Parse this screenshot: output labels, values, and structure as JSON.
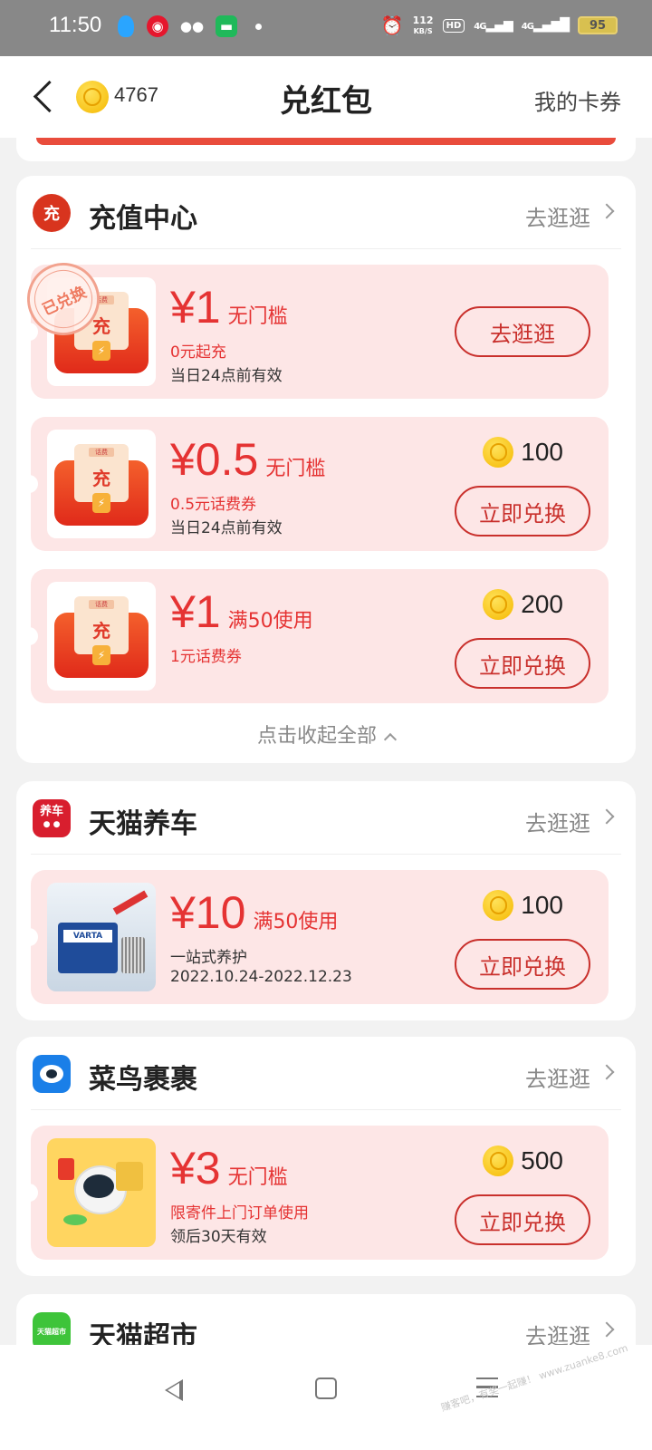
{
  "status_bar": {
    "time": "11:50",
    "network_speed_value": "112",
    "network_speed_unit": "KB/S",
    "hd_label": "HD",
    "signal_1": "4G",
    "signal_2": "4G",
    "battery": "95"
  },
  "header": {
    "coin_balance": "4767",
    "title": "兑红包",
    "my_coupons": "我的卡券"
  },
  "sections": [
    {
      "name": "充值中心",
      "logo_text": "充",
      "logo_color": "#d8341e",
      "link": "去逛逛",
      "coupons": [
        {
          "pack_tag": "话费",
          "pack_char": "充",
          "amount": "¥1",
          "condition": "无门槛",
          "line1": "0元起充",
          "line2": "当日24点前有效",
          "price": "",
          "button": "去逛逛",
          "stamp": "已兑换"
        },
        {
          "pack_tag": "话费",
          "pack_char": "充",
          "amount": "¥0.5",
          "condition": "无门槛",
          "line1": "0.5元话费券",
          "line2": "当日24点前有效",
          "price": "100",
          "button": "立即兑换"
        },
        {
          "pack_tag": "话费",
          "pack_char": "充",
          "amount": "¥1",
          "condition": "满50使用",
          "line1": "1元话费券",
          "line2": "",
          "price": "200",
          "button": "立即兑换"
        }
      ],
      "collapse_label": "点击收起全部"
    },
    {
      "name": "天猫养车",
      "logo_text": "养车",
      "logo_color": "#d81e2e",
      "link": "去逛逛",
      "coupons": [
        {
          "amount": "¥10",
          "condition": "满50使用",
          "line1": "一站式养护",
          "line2": "2022.10.24-2022.12.23",
          "price": "100",
          "button": "立即兑换",
          "image_brand": "VARTA"
        }
      ]
    },
    {
      "name": "菜鸟裹裹",
      "logo_color": "#1a7fe8",
      "link": "去逛逛",
      "coupons": [
        {
          "amount": "¥3",
          "condition": "无门槛",
          "line1": "限寄件上门订单使用",
          "line2": "领后30天有效",
          "price": "500",
          "button": "立即兑换"
        }
      ]
    },
    {
      "name": "天猫超市",
      "logo_text": "天猫超市",
      "logo_color": "#3ec43a",
      "link": "去逛逛"
    }
  ],
  "watermark": "赚客吧，有奖一起赚！ www.zuanke8.com",
  "colors": {
    "accent_red": "#e53333",
    "coupon_bg": "#fde6e6",
    "button_border": "#c9302c"
  }
}
